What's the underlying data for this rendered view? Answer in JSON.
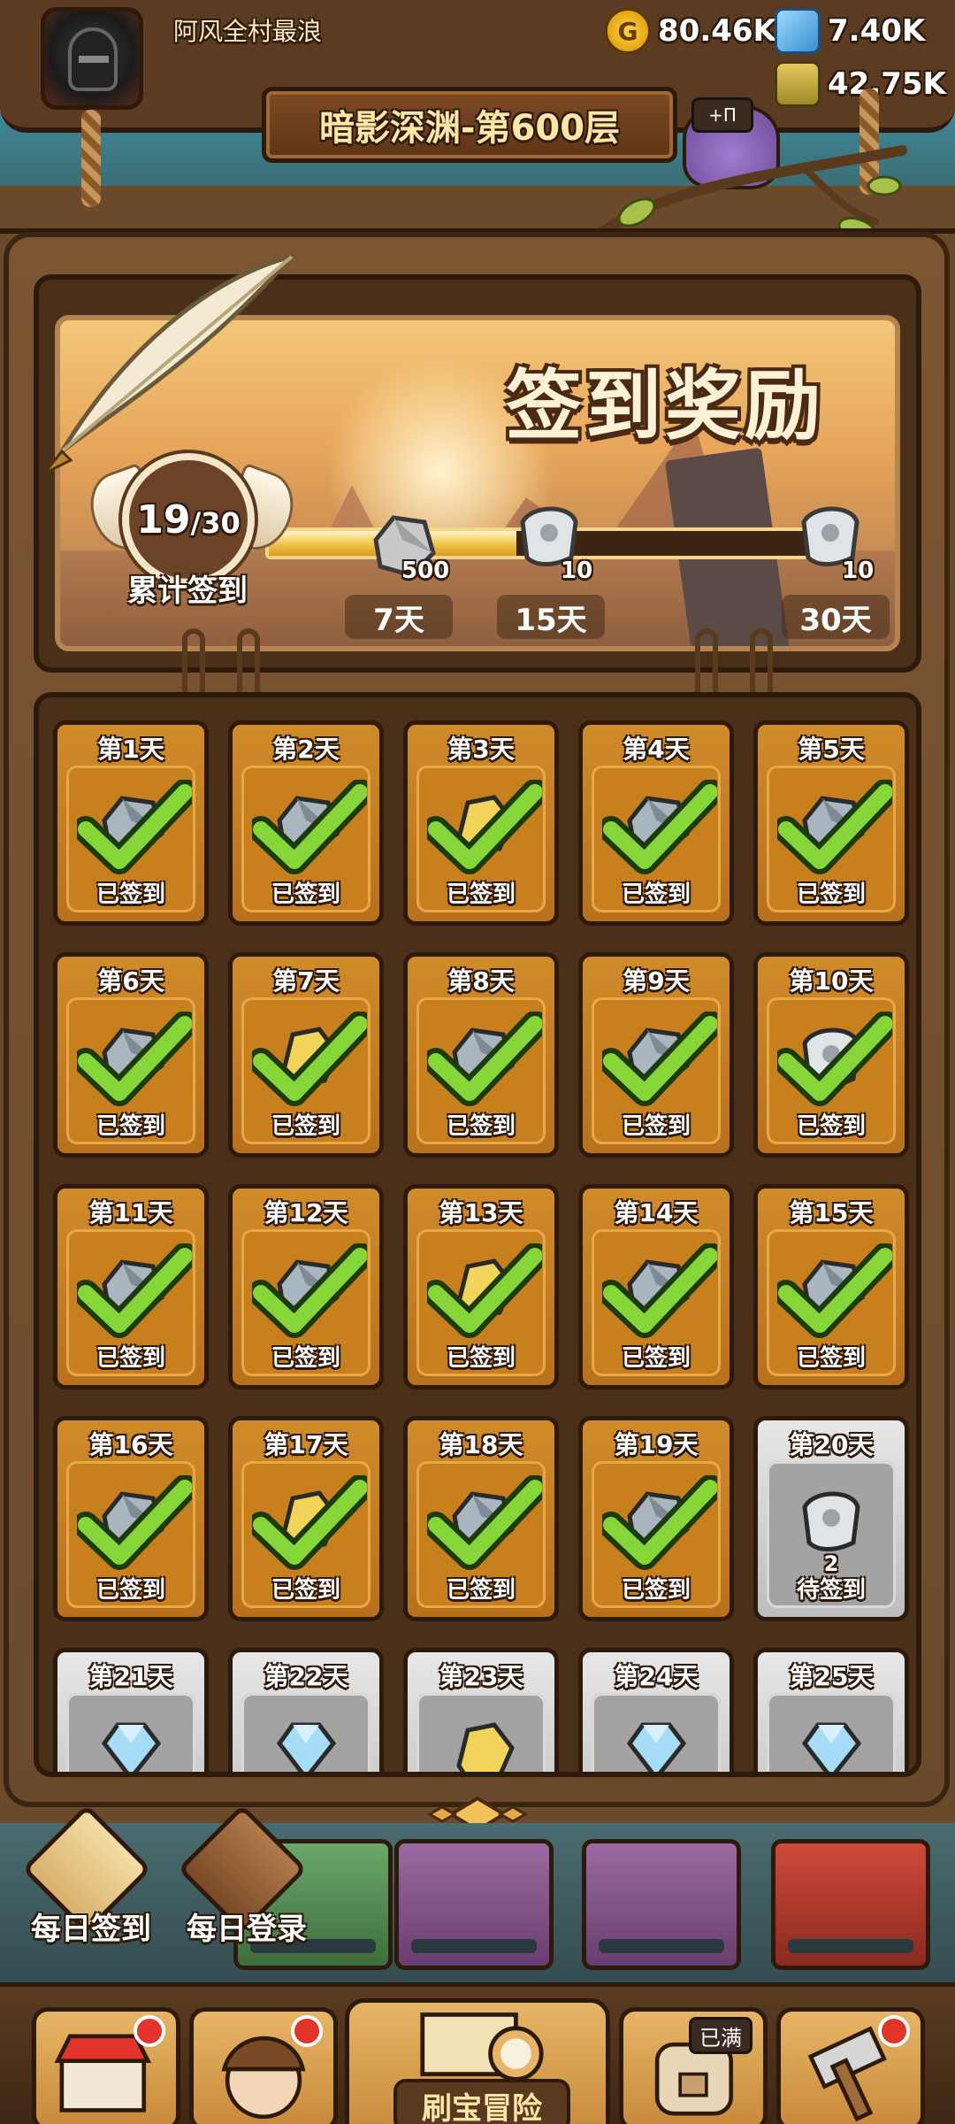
{
  "header": {
    "player_name": "阿风全村最浪",
    "resources": {
      "gold": "80.46K",
      "gems": "7.40K",
      "potion": "42.75K"
    },
    "level_title": "暗影深渊-第600层",
    "cat_button_label": "+Π"
  },
  "banner": {
    "title": "签到奖励",
    "progress": {
      "current": "19",
      "total": "/30",
      "label": "累计签到",
      "fraction": 0.43
    },
    "milestones": [
      {
        "day": "7天",
        "qty": "500",
        "icon": "stone-icon"
      },
      {
        "day": "15天",
        "qty": "10",
        "icon": "scroll-icon"
      },
      {
        "day": "30天",
        "qty": "10",
        "icon": "scroll-icon"
      }
    ]
  },
  "grid": {
    "done_label": "已签到",
    "todo_label": "待签到",
    "days": [
      {
        "label": "第1天",
        "done": true,
        "item": "stone"
      },
      {
        "label": "第2天",
        "done": true,
        "item": "stone"
      },
      {
        "label": "第3天",
        "done": true,
        "item": "gold"
      },
      {
        "label": "第4天",
        "done": true,
        "item": "stone"
      },
      {
        "label": "第5天",
        "done": true,
        "item": "stone"
      },
      {
        "label": "第6天",
        "done": true,
        "item": "stone"
      },
      {
        "label": "第7天",
        "done": true,
        "item": "gold"
      },
      {
        "label": "第8天",
        "done": true,
        "item": "stone"
      },
      {
        "label": "第9天",
        "done": true,
        "item": "stone"
      },
      {
        "label": "第10天",
        "done": true,
        "item": "scroll"
      },
      {
        "label": "第11天",
        "done": true,
        "item": "stone"
      },
      {
        "label": "第12天",
        "done": true,
        "item": "stone"
      },
      {
        "label": "第13天",
        "done": true,
        "item": "gold"
      },
      {
        "label": "第14天",
        "done": true,
        "item": "stone"
      },
      {
        "label": "第15天",
        "done": true,
        "item": "stone"
      },
      {
        "label": "第16天",
        "done": true,
        "item": "stone"
      },
      {
        "label": "第17天",
        "done": true,
        "item": "gold"
      },
      {
        "label": "第18天",
        "done": true,
        "item": "stone"
      },
      {
        "label": "第19天",
        "done": true,
        "item": "stone"
      },
      {
        "label": "第20天",
        "done": false,
        "item": "scroll",
        "qty": "2"
      },
      {
        "label": "第21天",
        "done": false,
        "item": "gem"
      },
      {
        "label": "第22天",
        "done": false,
        "item": "gem"
      },
      {
        "label": "第23天",
        "done": false,
        "item": "gold"
      },
      {
        "label": "第24天",
        "done": false,
        "item": "gem"
      },
      {
        "label": "第25天",
        "done": false,
        "item": "gem"
      }
    ]
  },
  "events": {
    "daily_checkin": "每日签到",
    "daily_login": "每日登录"
  },
  "nav": {
    "center_label": "刷宝冒险",
    "full_badge": "已满"
  },
  "colors": {
    "wood": "#6b4a2c",
    "card_done": "#c8801f",
    "card_todo": "#bdbdbd",
    "check_green": "#7ed23a",
    "nav_red_dot": "#e2342b"
  }
}
